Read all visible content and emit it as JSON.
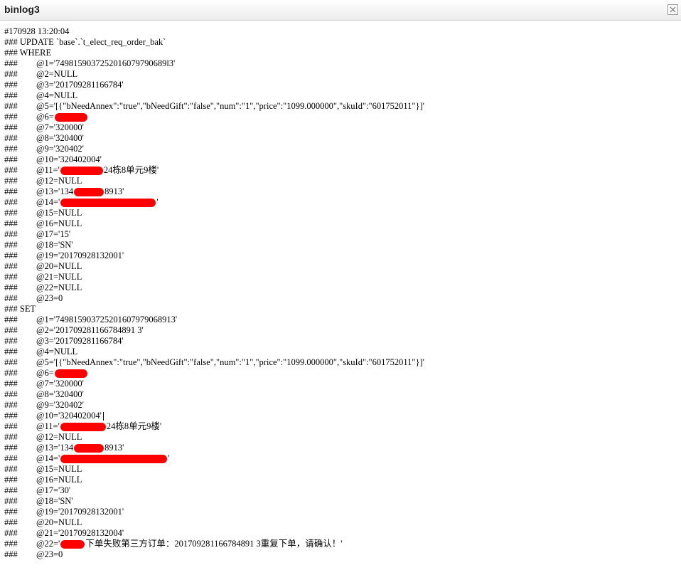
{
  "window": {
    "title": "binlog3"
  },
  "colors": {
    "redaction": "#ff0000",
    "text": "#000000"
  },
  "icons": {
    "close": "close-icon"
  },
  "lines": [
    {
      "type": "header",
      "text": "#170928 13:20:04"
    },
    {
      "type": "header",
      "text": "### UPDATE `base`.`t_elect_req_order_bak`"
    },
    {
      "type": "header",
      "text": "### WHERE"
    },
    {
      "type": "field",
      "prefix": "###",
      "text": "@1='7498159037252016079790689l3'"
    },
    {
      "type": "field",
      "prefix": "###",
      "text": "@2=NULL"
    },
    {
      "type": "field",
      "prefix": "###",
      "text": "@3='201709281166784'"
    },
    {
      "type": "field",
      "prefix": "###",
      "text": "@4=NULL"
    },
    {
      "type": "field",
      "prefix": "###",
      "text": "@5='[{\"bNeedAnnex\":\"true\",\"bNeedGift\":\"false\",\"num\":\"1\",\"price\":\"1099.000000\",\"skuId\":\"601752011\"}]'"
    },
    {
      "type": "field",
      "prefix": "###",
      "text": "@6=",
      "redact": 46
    },
    {
      "type": "field",
      "prefix": "###",
      "text": "@7='320000'"
    },
    {
      "type": "field",
      "prefix": "###",
      "text": "@8='320400'"
    },
    {
      "type": "field",
      "prefix": "###",
      "text": "@9='320402'"
    },
    {
      "type": "field",
      "prefix": "###",
      "text": "@10='320402004'"
    },
    {
      "type": "field",
      "prefix": "###",
      "text": "@11='",
      "redact": 60,
      "after": "24栋8单元9楼'"
    },
    {
      "type": "field",
      "prefix": "###",
      "text": "@12=NULL"
    },
    {
      "type": "field",
      "prefix": "###",
      "text": "@13='134",
      "redact": 42,
      "after": "8913'"
    },
    {
      "type": "field",
      "prefix": "###",
      "text": "@14='",
      "redact": 134,
      "after": "'"
    },
    {
      "type": "field",
      "prefix": "###",
      "text": "@15=NULL"
    },
    {
      "type": "field",
      "prefix": "###",
      "text": "@16=NULL"
    },
    {
      "type": "field",
      "prefix": "###",
      "text": "@17='15'"
    },
    {
      "type": "field",
      "prefix": "###",
      "text": "@18='SN'"
    },
    {
      "type": "field",
      "prefix": "###",
      "text": "@19='20170928132001'"
    },
    {
      "type": "field",
      "prefix": "###",
      "text": "@20=NULL"
    },
    {
      "type": "field",
      "prefix": "###",
      "text": "@21=NULL"
    },
    {
      "type": "field",
      "prefix": "###",
      "text": "@22=NULL"
    },
    {
      "type": "field",
      "prefix": "###",
      "text": "@23=0"
    },
    {
      "type": "header",
      "text": "### SET"
    },
    {
      "type": "field",
      "prefix": "###",
      "text": "@1='749815903725201607979068913'"
    },
    {
      "type": "field",
      "prefix": "###",
      "text": "@2='201709281166784891 3'"
    },
    {
      "type": "field",
      "prefix": "###",
      "text": "@3='201709281166784'"
    },
    {
      "type": "field",
      "prefix": "###",
      "text": "@4=NULL"
    },
    {
      "type": "field",
      "prefix": "###",
      "text": "@5='[{\"bNeedAnnex\":\"true\",\"bNeedGift\":\"false\",\"num\":\"1\",\"price\":\"1099.000000\",\"skuId\":\"601752011\"}]'"
    },
    {
      "type": "field",
      "prefix": "###",
      "text": "@6=",
      "redact": 46
    },
    {
      "type": "field",
      "prefix": "###",
      "text": "@7='320000'"
    },
    {
      "type": "field",
      "prefix": "###",
      "text": "@8='320400'"
    },
    {
      "type": "field",
      "prefix": "###",
      "text": "@9='320402'"
    },
    {
      "type": "field",
      "prefix": "###",
      "text": "@10='320402004'",
      "cursor": true
    },
    {
      "type": "field",
      "prefix": "###",
      "text": "@11='",
      "redact": 64,
      "after": "24栋8单元9楼'"
    },
    {
      "type": "field",
      "prefix": "###",
      "text": "@12=NULL"
    },
    {
      "type": "field",
      "prefix": "###",
      "text": "@13='134",
      "redact": 42,
      "after": "8913'"
    },
    {
      "type": "field",
      "prefix": "###",
      "text": "@14='",
      "redact": 150,
      "after": "'"
    },
    {
      "type": "field",
      "prefix": "###",
      "text": "@15=NULL"
    },
    {
      "type": "field",
      "prefix": "###",
      "text": "@16=NULL"
    },
    {
      "type": "field",
      "prefix": "###",
      "text": "@17='30'"
    },
    {
      "type": "field",
      "prefix": "###",
      "text": "@18='SN'"
    },
    {
      "type": "field",
      "prefix": "###",
      "text": "@19='20170928132001'"
    },
    {
      "type": "field",
      "prefix": "###",
      "text": "@20=NULL"
    },
    {
      "type": "field",
      "prefix": "###",
      "text": "@21='20170928132004'"
    },
    {
      "type": "field",
      "prefix": "###",
      "text": "@22='",
      "redact": 34,
      "after": "下单失败第三方订单：201709281166784891 3重复下单，请确认！'"
    },
    {
      "type": "field",
      "prefix": "###",
      "text": "@23=0"
    }
  ]
}
